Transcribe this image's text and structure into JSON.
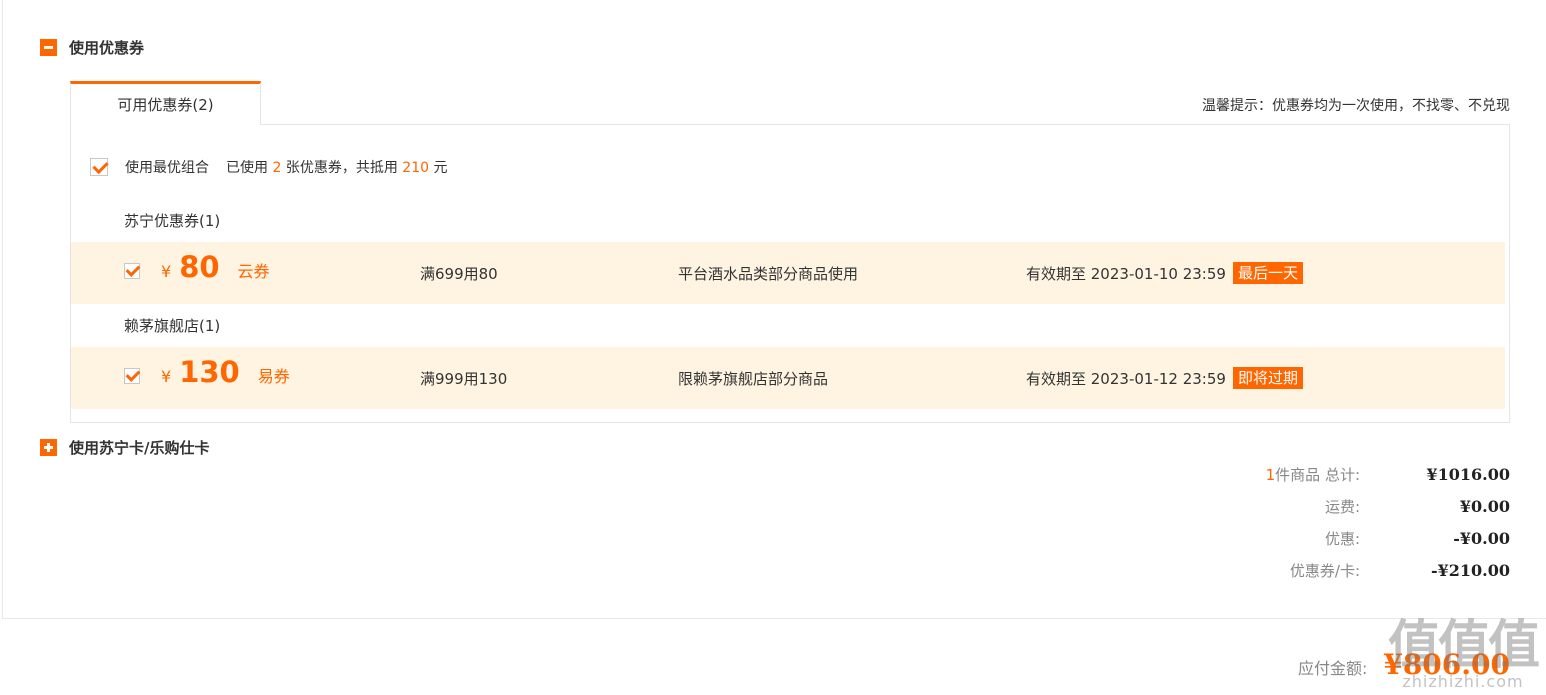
{
  "coupon_section": {
    "title": "使用优惠券",
    "tab_label": "可用优惠券(2)",
    "tip": "温馨提示：优惠券均为一次使用，不找零、不兑现",
    "best_combo": {
      "label": "使用最优组合",
      "used_prefix": "已使用",
      "count": "2",
      "count_suffix": "张优惠券，共抵用",
      "amount": "210",
      "amount_suffix": "元",
      "checked": true
    },
    "groups": [
      {
        "title": "苏宁优惠券(1)",
        "coupon": {
          "yen": "¥",
          "value": "80",
          "kind": "云券",
          "condition": "满699用80",
          "scope": "平台酒水品类部分商品使用",
          "validity": "有效期至 2023-01-10 23:59",
          "badge": "最后一天",
          "checked": true
        }
      },
      {
        "title": "赖茅旗舰店(1)",
        "coupon": {
          "yen": "¥",
          "value": "130",
          "kind": "易券",
          "condition": "满999用130",
          "scope": "限赖茅旗舰店部分商品",
          "validity": "有效期至 2023-01-12 23:59",
          "badge": "即将过期",
          "checked": true
        }
      }
    ]
  },
  "card_section": {
    "title": "使用苏宁卡/乐购仕卡"
  },
  "totals": {
    "items_count": "1",
    "items_label": "件商品 总计:",
    "items_total": "¥1016.00",
    "shipping_label": "运费:",
    "shipping": "¥0.00",
    "discount_label": "优惠:",
    "discount": "-¥0.00",
    "coupon_label": "优惠券/卡:",
    "coupon": "-¥210.00"
  },
  "payable": {
    "label": "应付金额:",
    "value": "¥806.00"
  },
  "watermark": {
    "chars": "值值值",
    "site": "zhizhizhi.com"
  },
  "colors": {
    "accent": "#ff6600",
    "row_bg": "#fff4e2"
  }
}
